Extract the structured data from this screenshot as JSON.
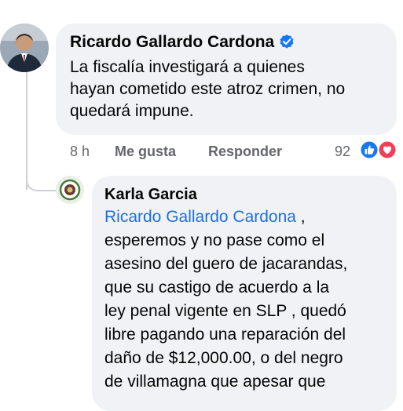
{
  "comment": {
    "author": "Ricardo Gallardo Cardona",
    "verified": true,
    "text": "La fiscalía investigará a quienes\nhayan cometido este atroz crimen, no\nquedará impune.",
    "time": "8 h",
    "like_label": "Me gusta",
    "reply_label": "Responder",
    "reaction_count": "92",
    "reactions": [
      "like-icon",
      "love-icon"
    ]
  },
  "reply": {
    "author": "Karla Garcia",
    "mention": "Ricardo Gallardo Cardona",
    "after_mention": " ,",
    "text": "esperemos y no pase como el\nasesino del guero de jacarandas,\nque su castigo de acuerdo a la\nley penal vigente en SLP ,  quedó\nlibre pagando una reparación del\ndaño de $12,000.00, o del negro\nde villamagna que apesar que"
  },
  "colors": {
    "bubble": "#f0f2f5",
    "mention": "#216fdb",
    "like": "#1877f2",
    "love": "#f33e58",
    "meta": "#65676b"
  }
}
